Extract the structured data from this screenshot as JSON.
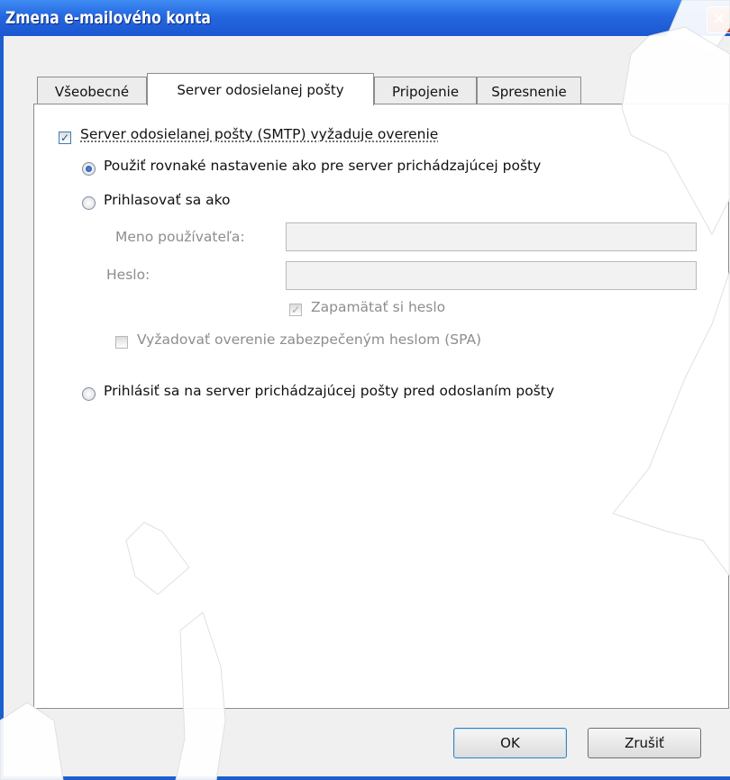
{
  "window": {
    "title": "Zmena e-mailového konta",
    "close_glyph": "✕"
  },
  "tabs": [
    {
      "label": "Všeobecné"
    },
    {
      "label": "Server odosielanej pošty"
    },
    {
      "label": "Pripojenie"
    },
    {
      "label": "Spresnenie"
    }
  ],
  "active_tab": "Server odosielanej pošty",
  "smtp": {
    "requires_auth_label": "Server odosielanej pošty (SMTP) vyžaduje overenie",
    "requires_auth_checked": true,
    "option_same_label": "Použiť rovnaké nastavenie ako pre server prichádzajúcej pošty",
    "option_same_selected": true,
    "option_login_label": "Prihlasovať sa ako",
    "username_label": "Meno používateľa:",
    "username_value": "",
    "password_label": "Heslo:",
    "password_value": "",
    "remember_label": "Zapamätať si heslo",
    "remember_checked": true,
    "spa_label": "Vyžadovať overenie zabezpečeným heslom (SPA)",
    "spa_checked": false,
    "option_incoming_label": "Prihlásiť sa na server prichádzajúcej pošty pred odoslaním pošty"
  },
  "buttons": {
    "ok": "OK",
    "cancel": "Zrušiť"
  },
  "colors": {
    "title_bar": "#2567e0",
    "dialog_bg": "#f0f0f0",
    "disabled_text": "#8d8d8d"
  }
}
